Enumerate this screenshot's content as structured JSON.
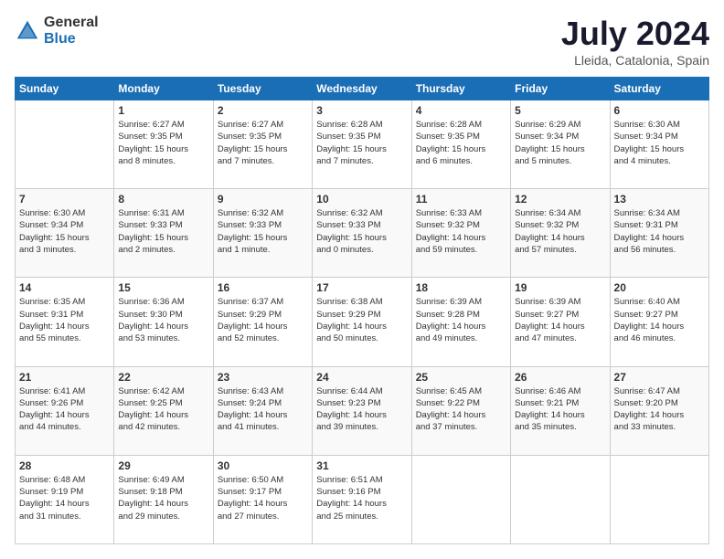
{
  "logo": {
    "general": "General",
    "blue": "Blue"
  },
  "title": "July 2024",
  "location": "Lleida, Catalonia, Spain",
  "days_of_week": [
    "Sunday",
    "Monday",
    "Tuesday",
    "Wednesday",
    "Thursday",
    "Friday",
    "Saturday"
  ],
  "weeks": [
    [
      {
        "day": "",
        "info": ""
      },
      {
        "day": "1",
        "info": "Sunrise: 6:27 AM\nSunset: 9:35 PM\nDaylight: 15 hours\nand 8 minutes."
      },
      {
        "day": "2",
        "info": "Sunrise: 6:27 AM\nSunset: 9:35 PM\nDaylight: 15 hours\nand 7 minutes."
      },
      {
        "day": "3",
        "info": "Sunrise: 6:28 AM\nSunset: 9:35 PM\nDaylight: 15 hours\nand 7 minutes."
      },
      {
        "day": "4",
        "info": "Sunrise: 6:28 AM\nSunset: 9:35 PM\nDaylight: 15 hours\nand 6 minutes."
      },
      {
        "day": "5",
        "info": "Sunrise: 6:29 AM\nSunset: 9:34 PM\nDaylight: 15 hours\nand 5 minutes."
      },
      {
        "day": "6",
        "info": "Sunrise: 6:30 AM\nSunset: 9:34 PM\nDaylight: 15 hours\nand 4 minutes."
      }
    ],
    [
      {
        "day": "7",
        "info": "Sunrise: 6:30 AM\nSunset: 9:34 PM\nDaylight: 15 hours\nand 3 minutes."
      },
      {
        "day": "8",
        "info": "Sunrise: 6:31 AM\nSunset: 9:33 PM\nDaylight: 15 hours\nand 2 minutes."
      },
      {
        "day": "9",
        "info": "Sunrise: 6:32 AM\nSunset: 9:33 PM\nDaylight: 15 hours\nand 1 minute."
      },
      {
        "day": "10",
        "info": "Sunrise: 6:32 AM\nSunset: 9:33 PM\nDaylight: 15 hours\nand 0 minutes."
      },
      {
        "day": "11",
        "info": "Sunrise: 6:33 AM\nSunset: 9:32 PM\nDaylight: 14 hours\nand 59 minutes."
      },
      {
        "day": "12",
        "info": "Sunrise: 6:34 AM\nSunset: 9:32 PM\nDaylight: 14 hours\nand 57 minutes."
      },
      {
        "day": "13",
        "info": "Sunrise: 6:34 AM\nSunset: 9:31 PM\nDaylight: 14 hours\nand 56 minutes."
      }
    ],
    [
      {
        "day": "14",
        "info": "Sunrise: 6:35 AM\nSunset: 9:31 PM\nDaylight: 14 hours\nand 55 minutes."
      },
      {
        "day": "15",
        "info": "Sunrise: 6:36 AM\nSunset: 9:30 PM\nDaylight: 14 hours\nand 53 minutes."
      },
      {
        "day": "16",
        "info": "Sunrise: 6:37 AM\nSunset: 9:29 PM\nDaylight: 14 hours\nand 52 minutes."
      },
      {
        "day": "17",
        "info": "Sunrise: 6:38 AM\nSunset: 9:29 PM\nDaylight: 14 hours\nand 50 minutes."
      },
      {
        "day": "18",
        "info": "Sunrise: 6:39 AM\nSunset: 9:28 PM\nDaylight: 14 hours\nand 49 minutes."
      },
      {
        "day": "19",
        "info": "Sunrise: 6:39 AM\nSunset: 9:27 PM\nDaylight: 14 hours\nand 47 minutes."
      },
      {
        "day": "20",
        "info": "Sunrise: 6:40 AM\nSunset: 9:27 PM\nDaylight: 14 hours\nand 46 minutes."
      }
    ],
    [
      {
        "day": "21",
        "info": "Sunrise: 6:41 AM\nSunset: 9:26 PM\nDaylight: 14 hours\nand 44 minutes."
      },
      {
        "day": "22",
        "info": "Sunrise: 6:42 AM\nSunset: 9:25 PM\nDaylight: 14 hours\nand 42 minutes."
      },
      {
        "day": "23",
        "info": "Sunrise: 6:43 AM\nSunset: 9:24 PM\nDaylight: 14 hours\nand 41 minutes."
      },
      {
        "day": "24",
        "info": "Sunrise: 6:44 AM\nSunset: 9:23 PM\nDaylight: 14 hours\nand 39 minutes."
      },
      {
        "day": "25",
        "info": "Sunrise: 6:45 AM\nSunset: 9:22 PM\nDaylight: 14 hours\nand 37 minutes."
      },
      {
        "day": "26",
        "info": "Sunrise: 6:46 AM\nSunset: 9:21 PM\nDaylight: 14 hours\nand 35 minutes."
      },
      {
        "day": "27",
        "info": "Sunrise: 6:47 AM\nSunset: 9:20 PM\nDaylight: 14 hours\nand 33 minutes."
      }
    ],
    [
      {
        "day": "28",
        "info": "Sunrise: 6:48 AM\nSunset: 9:19 PM\nDaylight: 14 hours\nand 31 minutes."
      },
      {
        "day": "29",
        "info": "Sunrise: 6:49 AM\nSunset: 9:18 PM\nDaylight: 14 hours\nand 29 minutes."
      },
      {
        "day": "30",
        "info": "Sunrise: 6:50 AM\nSunset: 9:17 PM\nDaylight: 14 hours\nand 27 minutes."
      },
      {
        "day": "31",
        "info": "Sunrise: 6:51 AM\nSunset: 9:16 PM\nDaylight: 14 hours\nand 25 minutes."
      },
      {
        "day": "",
        "info": ""
      },
      {
        "day": "",
        "info": ""
      },
      {
        "day": "",
        "info": ""
      }
    ]
  ]
}
